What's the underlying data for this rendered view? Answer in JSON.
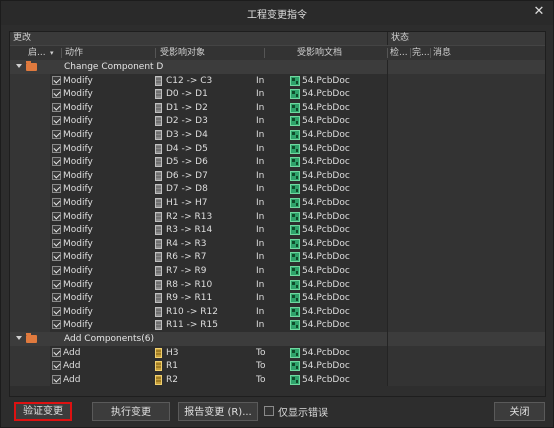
{
  "window": {
    "title": "工程变更指令",
    "close_glyph": "✕"
  },
  "panel": {
    "section_left": "更改",
    "section_right": "状态",
    "columns": {
      "enable": "启...",
      "action": "动作",
      "affected_object": "受影响对象",
      "affected_doc": "受影响文档",
      "check": "检...",
      "done": "完...",
      "message": "消息"
    }
  },
  "rows": [
    {
      "type": "group",
      "label": "Change Component D"
    },
    {
      "type": "item",
      "action": "Modify",
      "object": "C12 -> C3",
      "in": "In",
      "doc": "54.PcbDoc",
      "obj_icon": "component-icon"
    },
    {
      "type": "item",
      "action": "Modify",
      "object": "D0 -> D1",
      "in": "In",
      "doc": "54.PcbDoc",
      "obj_icon": "component-icon"
    },
    {
      "type": "item",
      "action": "Modify",
      "object": "D1 -> D2",
      "in": "In",
      "doc": "54.PcbDoc",
      "obj_icon": "component-icon"
    },
    {
      "type": "item",
      "action": "Modify",
      "object": "D2 -> D3",
      "in": "In",
      "doc": "54.PcbDoc",
      "obj_icon": "component-icon"
    },
    {
      "type": "item",
      "action": "Modify",
      "object": "D3 -> D4",
      "in": "In",
      "doc": "54.PcbDoc",
      "obj_icon": "component-icon"
    },
    {
      "type": "item",
      "action": "Modify",
      "object": "D4 -> D5",
      "in": "In",
      "doc": "54.PcbDoc",
      "obj_icon": "component-icon"
    },
    {
      "type": "item",
      "action": "Modify",
      "object": "D5 -> D6",
      "in": "In",
      "doc": "54.PcbDoc",
      "obj_icon": "component-icon"
    },
    {
      "type": "item",
      "action": "Modify",
      "object": "D6 -> D7",
      "in": "In",
      "doc": "54.PcbDoc",
      "obj_icon": "component-icon"
    },
    {
      "type": "item",
      "action": "Modify",
      "object": "D7 -> D8",
      "in": "In",
      "doc": "54.PcbDoc",
      "obj_icon": "component-icon"
    },
    {
      "type": "item",
      "action": "Modify",
      "object": "H1 -> H7",
      "in": "In",
      "doc": "54.PcbDoc",
      "obj_icon": "component-icon"
    },
    {
      "type": "item",
      "action": "Modify",
      "object": "R2 -> R13",
      "in": "In",
      "doc": "54.PcbDoc",
      "obj_icon": "component-icon"
    },
    {
      "type": "item",
      "action": "Modify",
      "object": "R3 -> R14",
      "in": "In",
      "doc": "54.PcbDoc",
      "obj_icon": "component-icon"
    },
    {
      "type": "item",
      "action": "Modify",
      "object": "R4 -> R3",
      "in": "In",
      "doc": "54.PcbDoc",
      "obj_icon": "component-icon"
    },
    {
      "type": "item",
      "action": "Modify",
      "object": "R6 -> R7",
      "in": "In",
      "doc": "54.PcbDoc",
      "obj_icon": "component-icon"
    },
    {
      "type": "item",
      "action": "Modify",
      "object": "R7 -> R9",
      "in": "In",
      "doc": "54.PcbDoc",
      "obj_icon": "component-icon"
    },
    {
      "type": "item",
      "action": "Modify",
      "object": "R8 -> R10",
      "in": "In",
      "doc": "54.PcbDoc",
      "obj_icon": "component-icon"
    },
    {
      "type": "item",
      "action": "Modify",
      "object": "R9 -> R11",
      "in": "In",
      "doc": "54.PcbDoc",
      "obj_icon": "component-icon"
    },
    {
      "type": "item",
      "action": "Modify",
      "object": "R10 -> R12",
      "in": "In",
      "doc": "54.PcbDoc",
      "obj_icon": "component-icon"
    },
    {
      "type": "item",
      "action": "Modify",
      "object": "R11 -> R15",
      "in": "In",
      "doc": "54.PcbDoc",
      "obj_icon": "component-icon"
    },
    {
      "type": "group",
      "label": "Add Components(6)"
    },
    {
      "type": "item",
      "action": "Add",
      "object": "H3",
      "in": "To",
      "doc": "54.PcbDoc",
      "obj_icon": "add-component-icon"
    },
    {
      "type": "item",
      "action": "Add",
      "object": "R1",
      "in": "To",
      "doc": "54.PcbDoc",
      "obj_icon": "add-component-icon"
    },
    {
      "type": "item",
      "action": "Add",
      "object": "R2",
      "in": "To",
      "doc": "54.PcbDoc",
      "obj_icon": "add-component-icon"
    }
  ],
  "footer": {
    "validate": "验证变更",
    "execute": "执行变更",
    "report": "报告变更 (R)...",
    "only_errors": "仅显示错误",
    "close": "关闭"
  },
  "colors": {
    "accent_focus": "#dd1111",
    "folder": "#e07a3e",
    "doc_icon": "#2fa36b"
  }
}
